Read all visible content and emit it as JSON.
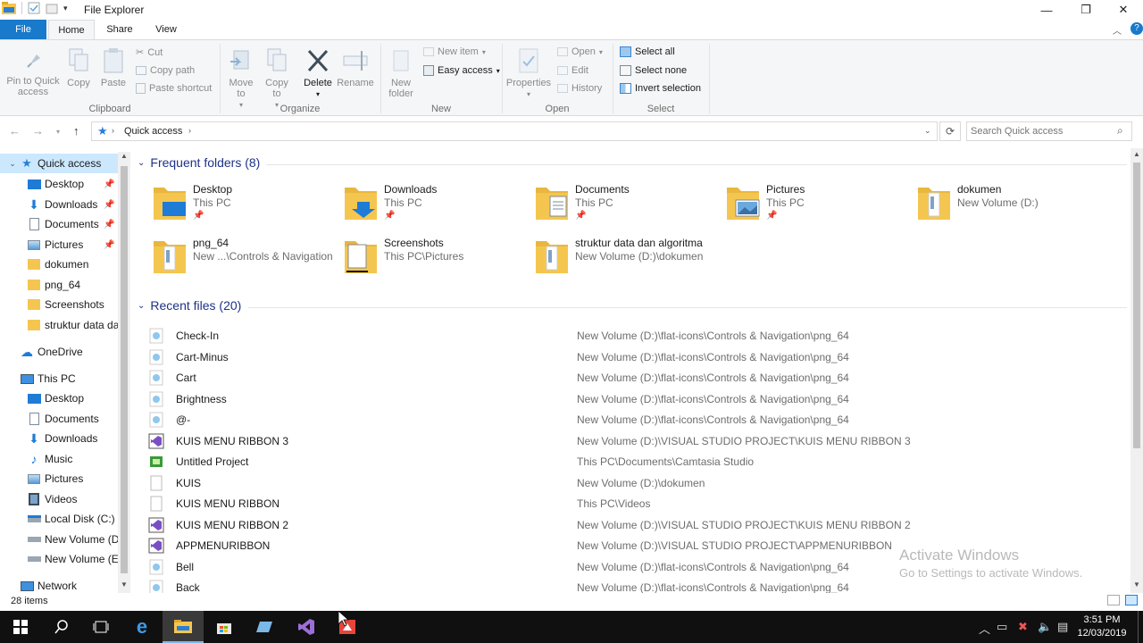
{
  "window": {
    "title": "File Explorer",
    "controls": {
      "minimize": "—",
      "maximize": "❐",
      "close": "✕"
    }
  },
  "ribbon_tabs": [
    "File",
    "Home",
    "Share",
    "View"
  ],
  "ribbon": {
    "clipboard": {
      "pin_label": "Pin to Quick access",
      "copy_label": "Copy",
      "paste_label": "Paste",
      "cut_label": "Cut",
      "copy_path_label": "Copy path",
      "paste_shortcut_label": "Paste shortcut",
      "group_label": "Clipboard"
    },
    "organize": {
      "move_label": "Move to",
      "copy_to_label": "Copy to",
      "delete_label": "Delete",
      "rename_label": "Rename",
      "group_label": "Organize"
    },
    "new": {
      "new_folder_label": "New folder",
      "new_item_label": "New item",
      "easy_access_label": "Easy access",
      "group_label": "New"
    },
    "open": {
      "properties_label": "Properties",
      "open_label": "Open",
      "edit_label": "Edit",
      "history_label": "History",
      "group_label": "Open"
    },
    "select": {
      "select_all_label": "Select all",
      "select_none_label": "Select none",
      "invert_label": "Invert selection",
      "group_label": "Select"
    }
  },
  "address": {
    "location": "Quick access",
    "search_placeholder": "Search Quick access"
  },
  "sidebar": {
    "quick_access": "Quick access",
    "qa_items": [
      {
        "label": "Desktop",
        "pinned": true
      },
      {
        "label": "Downloads",
        "pinned": true
      },
      {
        "label": "Documents",
        "pinned": true
      },
      {
        "label": "Pictures",
        "pinned": true
      },
      {
        "label": "dokumen",
        "pinned": false
      },
      {
        "label": "png_64",
        "pinned": false
      },
      {
        "label": "Screenshots",
        "pinned": false
      },
      {
        "label": "struktur data dan algoritma",
        "pinned": false
      }
    ],
    "onedrive": "OneDrive",
    "this_pc": "This PC",
    "pc_items": [
      "Desktop",
      "Documents",
      "Downloads",
      "Music",
      "Pictures",
      "Videos",
      "Local Disk (C:)",
      "New Volume (D:)",
      "New Volume (E:)"
    ],
    "network": "Network"
  },
  "frequent": {
    "header": "Frequent folders (8)",
    "folders": [
      {
        "name": "Desktop",
        "path": "This PC",
        "pinned": true,
        "icon": "desktop"
      },
      {
        "name": "Downloads",
        "path": "This PC",
        "pinned": true,
        "icon": "downloads"
      },
      {
        "name": "Documents",
        "path": "This PC",
        "pinned": true,
        "icon": "documents"
      },
      {
        "name": "Pictures",
        "path": "This PC",
        "pinned": true,
        "icon": "pictures"
      },
      {
        "name": "dokumen",
        "path": "New Volume (D:)",
        "pinned": false,
        "icon": "plain"
      },
      {
        "name": "png_64",
        "path": "New ...\\Controls & Navigation",
        "pinned": false,
        "icon": "plain"
      },
      {
        "name": "Screenshots",
        "path": "This PC\\Pictures",
        "pinned": false,
        "icon": "screenshots"
      },
      {
        "name": "struktur data dan algoritma",
        "path": "New Volume (D:)\\dokumen",
        "pinned": false,
        "icon": "plain"
      }
    ]
  },
  "recent": {
    "header": "Recent files (20)",
    "files": [
      {
        "name": "Check-In",
        "path": "New Volume (D:)\\flat-icons\\Controls & Navigation\\png_64",
        "icon": "png"
      },
      {
        "name": "Cart-Minus",
        "path": "New Volume (D:)\\flat-icons\\Controls & Navigation\\png_64",
        "icon": "png"
      },
      {
        "name": "Cart",
        "path": "New Volume (D:)\\flat-icons\\Controls & Navigation\\png_64",
        "icon": "png"
      },
      {
        "name": "Brightness",
        "path": "New Volume (D:)\\flat-icons\\Controls & Navigation\\png_64",
        "icon": "png"
      },
      {
        "name": "@-",
        "path": "New Volume (D:)\\flat-icons\\Controls & Navigation\\png_64",
        "icon": "png"
      },
      {
        "name": "KUIS MENU RIBBON 3",
        "path": "New Volume (D:)\\VISUAL STUDIO PROJECT\\KUIS MENU RIBBON 3",
        "icon": "vs"
      },
      {
        "name": "Untitled Project",
        "path": "This PC\\Documents\\Camtasia Studio",
        "icon": "camtasia"
      },
      {
        "name": "KUIS",
        "path": "New Volume (D:)\\dokumen",
        "icon": "blank"
      },
      {
        "name": "KUIS MENU RIBBON",
        "path": "This PC\\Videos",
        "icon": "blank"
      },
      {
        "name": "KUIS MENU RIBBON 2",
        "path": "New Volume (D:)\\VISUAL STUDIO PROJECT\\KUIS MENU RIBBON 2",
        "icon": "vs"
      },
      {
        "name": "APPMENURIBBON",
        "path": "New Volume (D:)\\VISUAL STUDIO PROJECT\\APPMENURIBBON",
        "icon": "vs"
      },
      {
        "name": "Bell",
        "path": "New Volume (D:)\\flat-icons\\Controls & Navigation\\png_64",
        "icon": "png"
      },
      {
        "name": "Back",
        "path": "New Volume (D:)\\flat-icons\\Controls & Navigation\\png_64",
        "icon": "png"
      }
    ]
  },
  "status": {
    "items": "28 items"
  },
  "watermark": {
    "line1": "Activate Windows",
    "line2": "Go to Settings to activate Windows."
  },
  "clock": {
    "time": "3:51 PM",
    "date": "12/03/2019"
  },
  "colors": {
    "accent": "#1979ca",
    "folder": "#f5c64f",
    "selection": "#cce8ff",
    "link_header": "#1e3287"
  }
}
